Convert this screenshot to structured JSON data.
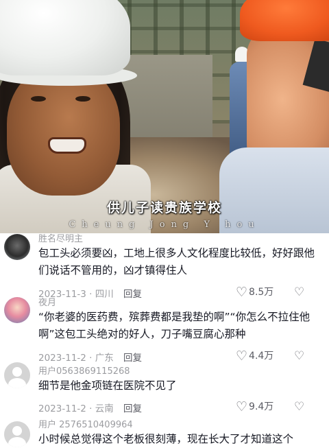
{
  "video": {
    "subtitle_cn": "供儿子读贵族学校",
    "subtitle_en": "Cheung  Jong  Y  hou"
  },
  "comments": [
    {
      "username": "胜名尽明主",
      "text": "包工头必须要凶，工地上很多人文化程度比较低，好好跟他们说话不管用的，凶才镇得住人",
      "date": "2023-11-3",
      "location": "四川",
      "reply": "回复",
      "likes": "8.5万"
    },
    {
      "username": "夜月",
      "text": "“你老婆的医药费，殡葬费都是我垫的啊”“你怎么不拉住他啊”这包工头绝对的好人，刀子嘴豆腐心那种",
      "date": "2023-11-2",
      "location": "广东",
      "reply": "回复",
      "likes": "4.4万"
    },
    {
      "username": "用户0563869115268",
      "text": "细节是他金项链在医院不见了",
      "date": "2023-11-2",
      "location": "云南",
      "reply": "回复",
      "likes": "9.4万"
    },
    {
      "username": "用户 2576510409964",
      "text": "小时候总觉得这个老板很刻薄，现在长大了才知道这个"
    }
  ],
  "icons": {
    "like": "heart-outline-icon",
    "dislike": "broken-heart-icon",
    "avatar_placeholder": "default-user-icon"
  },
  "colors": {
    "secondary_text": "#9b9ca0",
    "primary_text": "#161823"
  }
}
